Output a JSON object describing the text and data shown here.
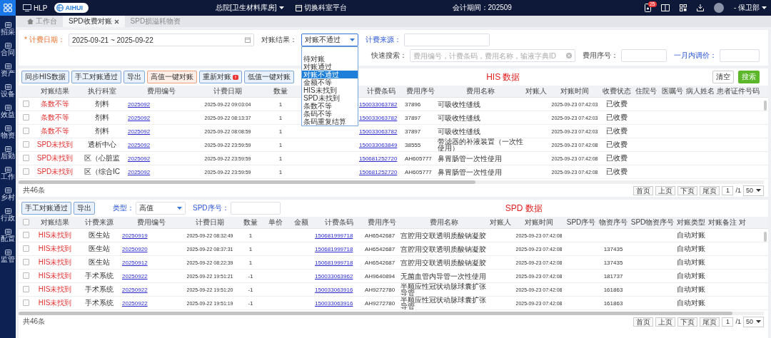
{
  "top_bar": {
    "app_name": "HLP",
    "logo_text": "AIHUI",
    "location": "总院[卫生材料库房]",
    "switch_label": "切换科室平台",
    "accounting_period": "会计期间：202509",
    "notification_count": "25",
    "user": "- 保卫部"
  },
  "sidebar": {
    "items": [
      {
        "label": "招采"
      },
      {
        "label": "合同"
      },
      {
        "label": "资产"
      },
      {
        "label": "设备"
      },
      {
        "label": "效益"
      },
      {
        "label": "物资"
      },
      {
        "label": "后勤"
      },
      {
        "label": "工作"
      },
      {
        "label": "乡村"
      },
      {
        "label": "行政"
      },
      {
        "label": "配置"
      },
      {
        "label": "监管"
      }
    ]
  },
  "tabs": [
    {
      "label": "工作台",
      "selected": false,
      "closable": false
    },
    {
      "label": "SPD收费对账",
      "selected": true,
      "closable": true
    },
    {
      "label": "SPD损溢耗物资",
      "selected": false,
      "closable": false
    }
  ],
  "filters": [
    {
      "kind": "date-range",
      "label": "* 计费日期：",
      "required": true,
      "value": "2025-09-21 ~ 2025-09-22"
    },
    {
      "kind": "select",
      "label": "对账结果：",
      "value": "对账不通过",
      "expanded": true,
      "options": [
        {
          "label": "待对账",
          "selected": false
        },
        {
          "label": "对账通过",
          "selected": false
        },
        {
          "label": "对账不通过",
          "selected": true
        },
        {
          "label": "金额不等",
          "selected": false
        },
        {
          "label": "HIS未找到",
          "selected": false
        },
        {
          "label": "SPD未找到",
          "selected": false
        },
        {
          "label": "条数不等",
          "selected": false
        },
        {
          "label": "条码不等",
          "selected": false
        },
        {
          "label": "条码重复结算",
          "selected": false
        }
      ]
    },
    {
      "kind": "input",
      "label": "计费来源：",
      "highlighted": true
    },
    {
      "kind": "search",
      "label": "快速搜索：",
      "placeholder": "费用编号，计费条码，费用名称，输液字典ID"
    },
    {
      "kind": "input",
      "label": "费用序号：",
      "highlighted": false
    },
    {
      "kind": "input",
      "label": "一月内调价：",
      "highlighted": true
    }
  ],
  "his_panel": {
    "title": "HIS 数据",
    "buttons": [
      {
        "label": "同步HIS数据",
        "kind": "default",
        "badge": false
      },
      {
        "label": "手工对账通过",
        "kind": "default",
        "badge": false
      },
      {
        "label": "导出",
        "kind": "default",
        "badge": false
      },
      {
        "label": "高值一键对账",
        "kind": "warning",
        "badge": false
      },
      {
        "label": "重新对账",
        "kind": "default",
        "badge": true
      },
      {
        "label": "低值一键对账",
        "kind": "default",
        "badge": false
      }
    ],
    "actions": [
      {
        "label": "清空",
        "kind": "plain"
      },
      {
        "label": "搜索",
        "kind": "primary"
      }
    ],
    "columns": [
      "对账结果",
      "执行科室",
      "费用编号",
      "计费日期",
      "数量",
      null,
      null,
      "计费条码",
      "费用序号",
      "费用名称",
      "对账人",
      "对账时间",
      "收费状态",
      "住院号",
      "医嘱号",
      "病人姓名",
      "患者证件号码"
    ],
    "rows": [
      {
        "checked": false,
        "cells": [
          "条数不等",
          "剂料",
          "2025092",
          "2025-09-22 09:03:04",
          "1",
          null,
          null,
          "150033063782",
          "37896",
          "可吸收性缝线",
          null,
          "2025-09-23 07:42:03",
          "已收费",
          null,
          null,
          null,
          null
        ]
      },
      {
        "checked": false,
        "cells": [
          "条数不等",
          "剂料",
          "2025092",
          "2025-09-22 08:13:37",
          "1",
          null,
          null,
          "150033063782",
          "37897",
          "可吸收性缝线",
          null,
          "2025-09-23 07:42:03",
          "已收费",
          null,
          null,
          null,
          null
        ]
      },
      {
        "checked": false,
        "cells": [
          "条数不等",
          "剂料",
          "2025092",
          "2025-09-22 08:08:59",
          "1",
          null,
          null,
          "150033063782",
          "37897",
          "可吸收性缝线",
          null,
          "2025-09-23 07:42:03",
          "已收费",
          null,
          null,
          null,
          null
        ]
      },
      {
        "checked": false,
        "cells": [
          "SPD未找到",
          "透析中心",
          "2025092",
          "2025-09-22 23:59:59",
          "1",
          null,
          null,
          "150033063849",
          "38555",
          "带滤器的补液装置（一次性使用）",
          null,
          "2025-09-23 07:42:08",
          "已收费",
          null,
          null,
          null,
          null
        ]
      },
      {
        "checked": false,
        "cells": [
          "SPD未找到",
          "区（心脏监",
          "2025092",
          "2025-09-22 23:59:59",
          "1",
          null,
          null,
          "150681252720",
          "AH605777",
          "鼻胃肠管一次性使用",
          null,
          "2025-09-23 07:42:08",
          "已收费",
          null,
          null,
          null,
          null
        ]
      },
      {
        "checked": false,
        "cells": [
          "SPD未找到",
          "区（综合IC",
          "2025092",
          "2025-09-22 23:59:59",
          "1",
          null,
          null,
          "150681252720",
          "AH605777",
          "鼻胃肠管一次性使用",
          null,
          "2025-09-23 07:42:08",
          "已收费",
          null,
          null,
          null,
          null
        ]
      }
    ],
    "total": "共46条",
    "pagination": {
      "first": "首页",
      "prev": "上页",
      "next": "下页",
      "last": "尾页",
      "page": "1",
      "total_pages": "/1",
      "page_size": "50"
    }
  },
  "spd_panel": {
    "title": "SPD 数据",
    "buttons": [
      {
        "label": "手工对账通过",
        "kind": "default",
        "badge": false
      },
      {
        "label": "导出",
        "kind": "default",
        "badge": false
      }
    ],
    "filters": [
      {
        "kind": "select",
        "label": "类型：",
        "highlighted": true,
        "value": "高值"
      },
      {
        "kind": "input",
        "label": "SPD序号：",
        "highlighted": true
      }
    ],
    "select_all": {
      "checked": false
    },
    "columns": [
      "对账结果",
      "计费来源",
      "费用编号",
      "计费日期",
      "数量",
      "单价",
      "金额",
      "计费条码",
      "费用序号",
      "费用名称",
      "对账人",
      "对账时间",
      "SPD序号",
      "物资序号",
      "SPD物资序号",
      "对账类型",
      "对账备注",
      "对"
    ],
    "rows": [
      {
        "checked": false,
        "cells": [
          "HIS未找到",
          "医生站",
          "20250919",
          "2025-09-22 08:32:49",
          "1",
          null,
          null,
          "150681999718",
          "AH6542687",
          "宫腔用交联透明质酸钠凝胶",
          null,
          "2025-09-23 07:42:08",
          null,
          null,
          null,
          "自动对账",
          null,
          null
        ]
      },
      {
        "checked": false,
        "cells": [
          "HIS未找到",
          "医生站",
          "20250920",
          "2025-09-22 08:37:31",
          "1",
          null,
          null,
          "150681999718",
          "AH6542687",
          "宫腔用交联透明质酸钠凝胶",
          null,
          "2025-09-23 07:42:08",
          null,
          "137435",
          null,
          "自动对账",
          null,
          null
        ]
      },
      {
        "checked": false,
        "cells": [
          "HIS未找到",
          "医生站",
          "20250912",
          "2025-09-22 08:22:39",
          "1",
          null,
          null,
          "150681999718",
          "AH6542687",
          "宫腔用交联透明质酸钠凝胶",
          null,
          "2025-09-23 07:42:08",
          null,
          "137435",
          null,
          "自动对账",
          null,
          null
        ]
      },
      {
        "checked": false,
        "cells": [
          "HIS未找到",
          "手术系统",
          "20250922",
          "2025-09-22 19:51:21",
          "-1",
          null,
          null,
          "150033063962",
          "AH9640894",
          "无菌血管内导管一次性使用",
          null,
          "2025-09-23 07:42:08",
          null,
          "181737",
          null,
          "自动对账",
          null,
          null
        ]
      },
      {
        "checked": false,
        "cells": [
          "HIS未找到",
          "手术系统",
          "20250922",
          "2025-09-22 19:51:20",
          "-1",
          null,
          null,
          "150033063916",
          "AH9272780",
          "半顺应性冠状动脉球囊扩张导管",
          null,
          "2025-09-23 07:42:08",
          null,
          "161863",
          null,
          "自动对账",
          null,
          null
        ]
      },
      {
        "checked": false,
        "cells": [
          "HIS未找到",
          "手术系统",
          "20250922",
          "2025-09-22 19:51:19",
          "-1",
          null,
          null,
          "150033063916",
          "AH9272780",
          "半顺应性冠状动脉球囊扩张导管",
          null,
          "2025-09-23 07:42:08",
          null,
          "161863",
          null,
          "自动对账",
          null,
          null
        ]
      }
    ],
    "total": "共46条",
    "pagination": {
      "first": "首页",
      "prev": "上页",
      "next": "下页",
      "last": "尾页",
      "page": "1",
      "total_pages": "/1",
      "page_size": "50"
    }
  }
}
